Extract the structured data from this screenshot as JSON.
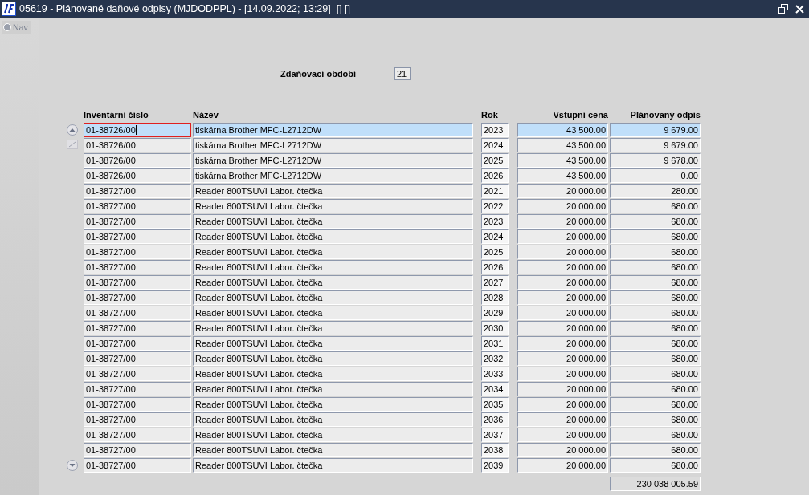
{
  "window": {
    "title": "05619 - Plánované daňové odpisy (MJDODPPL) - [14.09.2022; 13:29]  [] []"
  },
  "sidebar": {
    "items": [
      {
        "label": "Nav",
        "selected": false
      }
    ]
  },
  "period": {
    "label": "Zdaňovací období",
    "value": "21"
  },
  "table": {
    "columns": [
      "Inventární číslo",
      "Název",
      "Rok",
      "Vstupní cena",
      "Plánovaný odpis"
    ],
    "rows": [
      {
        "cells": [
          "01-38726/00",
          "tiskárna Brother MFC-L2712DW",
          "2023",
          "43 500.00",
          "9 679.00"
        ],
        "selected": true,
        "focused": true
      },
      {
        "cells": [
          "01-38726/00",
          "tiskárna Brother MFC-L2712DW",
          "2024",
          "43 500.00",
          "9 679.00"
        ],
        "selected": false,
        "focused": false
      },
      {
        "cells": [
          "01-38726/00",
          "tiskárna Brother MFC-L2712DW",
          "2025",
          "43 500.00",
          "9 678.00"
        ],
        "selected": false,
        "focused": false
      },
      {
        "cells": [
          "01-38726/00",
          "tiskárna Brother MFC-L2712DW",
          "2026",
          "43 500.00",
          "0.00"
        ],
        "selected": false,
        "focused": false
      },
      {
        "cells": [
          "01-38727/00",
          "Reader 800TSUVI Labor. čtečka",
          "2021",
          "20 000.00",
          "280.00"
        ],
        "selected": false,
        "focused": false
      },
      {
        "cells": [
          "01-38727/00",
          "Reader 800TSUVI Labor. čtečka",
          "2022",
          "20 000.00",
          "680.00"
        ],
        "selected": false,
        "focused": false
      },
      {
        "cells": [
          "01-38727/00",
          "Reader 800TSUVI Labor. čtečka",
          "2023",
          "20 000.00",
          "680.00"
        ],
        "selected": false,
        "focused": false
      },
      {
        "cells": [
          "01-38727/00",
          "Reader 800TSUVI Labor. čtečka",
          "2024",
          "20 000.00",
          "680.00"
        ],
        "selected": false,
        "focused": false
      },
      {
        "cells": [
          "01-38727/00",
          "Reader 800TSUVI Labor. čtečka",
          "2025",
          "20 000.00",
          "680.00"
        ],
        "selected": false,
        "focused": false
      },
      {
        "cells": [
          "01-38727/00",
          "Reader 800TSUVI Labor. čtečka",
          "2026",
          "20 000.00",
          "680.00"
        ],
        "selected": false,
        "focused": false
      },
      {
        "cells": [
          "01-38727/00",
          "Reader 800TSUVI Labor. čtečka",
          "2027",
          "20 000.00",
          "680.00"
        ],
        "selected": false,
        "focused": false
      },
      {
        "cells": [
          "01-38727/00",
          "Reader 800TSUVI Labor. čtečka",
          "2028",
          "20 000.00",
          "680.00"
        ],
        "selected": false,
        "focused": false
      },
      {
        "cells": [
          "01-38727/00",
          "Reader 800TSUVI Labor. čtečka",
          "2029",
          "20 000.00",
          "680.00"
        ],
        "selected": false,
        "focused": false
      },
      {
        "cells": [
          "01-38727/00",
          "Reader 800TSUVI Labor. čtečka",
          "2030",
          "20 000.00",
          "680.00"
        ],
        "selected": false,
        "focused": false
      },
      {
        "cells": [
          "01-38727/00",
          "Reader 800TSUVI Labor. čtečka",
          "2031",
          "20 000.00",
          "680.00"
        ],
        "selected": false,
        "focused": false
      },
      {
        "cells": [
          "01-38727/00",
          "Reader 800TSUVI Labor. čtečka",
          "2032",
          "20 000.00",
          "680.00"
        ],
        "selected": false,
        "focused": false
      },
      {
        "cells": [
          "01-38727/00",
          "Reader 800TSUVI Labor. čtečka",
          "2033",
          "20 000.00",
          "680.00"
        ],
        "selected": false,
        "focused": false
      },
      {
        "cells": [
          "01-38727/00",
          "Reader 800TSUVI Labor. čtečka",
          "2034",
          "20 000.00",
          "680.00"
        ],
        "selected": false,
        "focused": false
      },
      {
        "cells": [
          "01-38727/00",
          "Reader 800TSUVI Labor. čtečka",
          "2035",
          "20 000.00",
          "680.00"
        ],
        "selected": false,
        "focused": false
      },
      {
        "cells": [
          "01-38727/00",
          "Reader 800TSUVI Labor. čtečka",
          "2036",
          "20 000.00",
          "680.00"
        ],
        "selected": false,
        "focused": false
      },
      {
        "cells": [
          "01-38727/00",
          "Reader 800TSUVI Labor. čtečka",
          "2037",
          "20 000.00",
          "680.00"
        ],
        "selected": false,
        "focused": false
      },
      {
        "cells": [
          "01-38727/00",
          "Reader 800TSUVI Labor. čtečka",
          "2038",
          "20 000.00",
          "680.00"
        ],
        "selected": false,
        "focused": false
      },
      {
        "cells": [
          "01-38727/00",
          "Reader 800TSUVI Labor. čtečka",
          "2039",
          "20 000.00",
          "680.00"
        ],
        "selected": false,
        "focused": false
      }
    ],
    "total": "230 038 005.59"
  }
}
